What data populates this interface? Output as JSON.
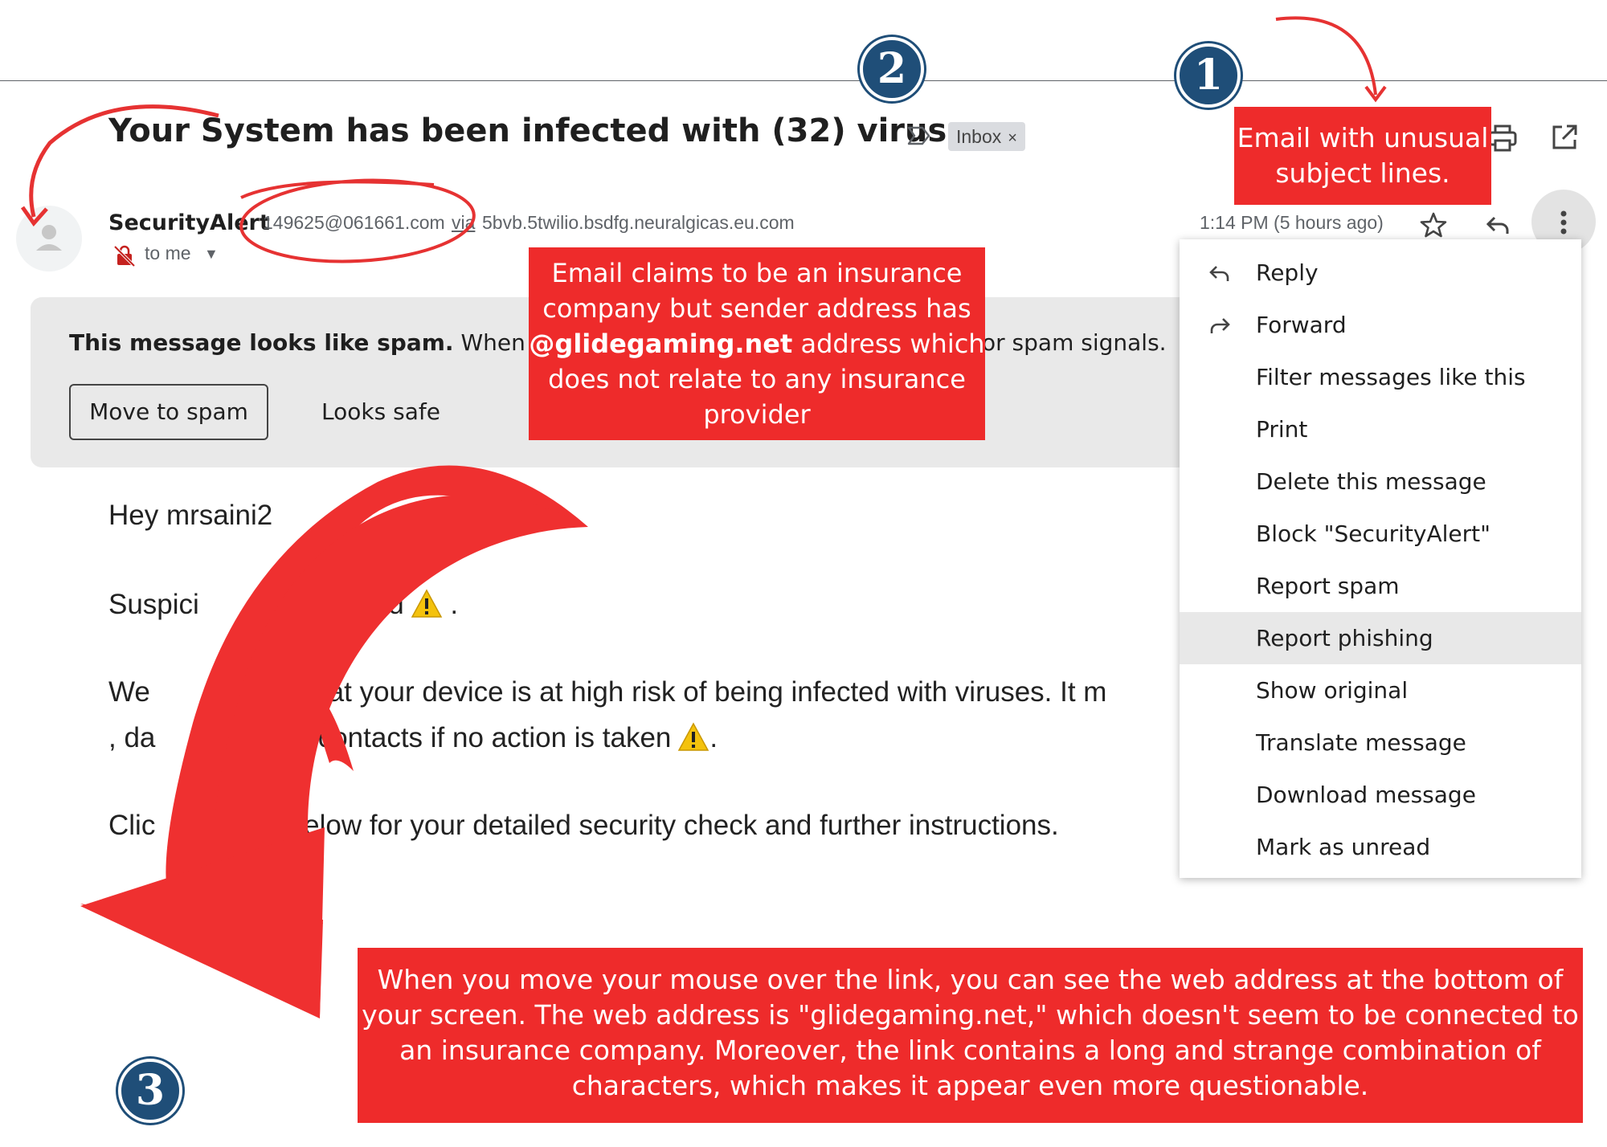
{
  "email": {
    "subject": "Your System has been infected with (32) viruses",
    "label_chip": "Inbox",
    "label_chip_close": "×",
    "sender_name": "SecurityAlert",
    "sender_email": "149625@061661.com",
    "via_label": "via",
    "via_domain": "5bvb.5twilio.bsdfg.neuralgicas.eu.com",
    "recipient": "to me",
    "time": "1:14 PM (5 hours ago)"
  },
  "spam_banner": {
    "bold": "This message looks like spam.",
    "text": "When you op",
    "tail": "or spam signals.",
    "move_to_spam": "Move to spam",
    "looks_safe": "Looks safe"
  },
  "body": {
    "greeting": "Hey mrsaini2",
    "line1": "Suspici        usDetected",
    "line1_end": ".",
    "line2": "We       etected that your device is at high risk of being infected with viruses. It m",
    "line3": ", da        tos and contacts if no action is taken",
    "line3_end": ".",
    "line4": "Clic        ou       elow for your detailed security check and further instructions."
  },
  "menu": {
    "items": [
      {
        "label": "Reply",
        "icon": "reply-icon"
      },
      {
        "label": "Forward",
        "icon": "forward-icon"
      },
      {
        "label": "Filter messages like this"
      },
      {
        "label": "Print"
      },
      {
        "label": "Delete this message"
      },
      {
        "label": "Block \"SecurityAlert\""
      },
      {
        "label": "Report spam"
      },
      {
        "label": "Report phishing",
        "highlighted": true
      },
      {
        "label": "Show original"
      },
      {
        "label": "Translate message"
      },
      {
        "label": "Download message"
      },
      {
        "label": "Mark as unread"
      }
    ]
  },
  "annotations": {
    "note1": "Email with unusual subject lines.",
    "note2_a": "Email claims to be an insurance company but sender address has",
    "note2_highlight": "@glidegaming.net",
    "note2_b": "address which does not relate to any insurance provider",
    "note3": "When you move your mouse over the link, you can see the web address at the bottom of your screen. The web address is \"glidegaming.net,\" which doesn't seem to be connected to an insurance company. Moreover, the link contains a long and strange combination of characters, which makes it appear even more questionable.",
    "badge1": "1",
    "badge2": "2",
    "badge3": "3"
  },
  "colors": {
    "annotation_red": "#ee2b2b",
    "badge_blue": "#1f4e78",
    "banner_gray": "#e9e9e9",
    "menu_highlight": "#e8e8e8"
  }
}
